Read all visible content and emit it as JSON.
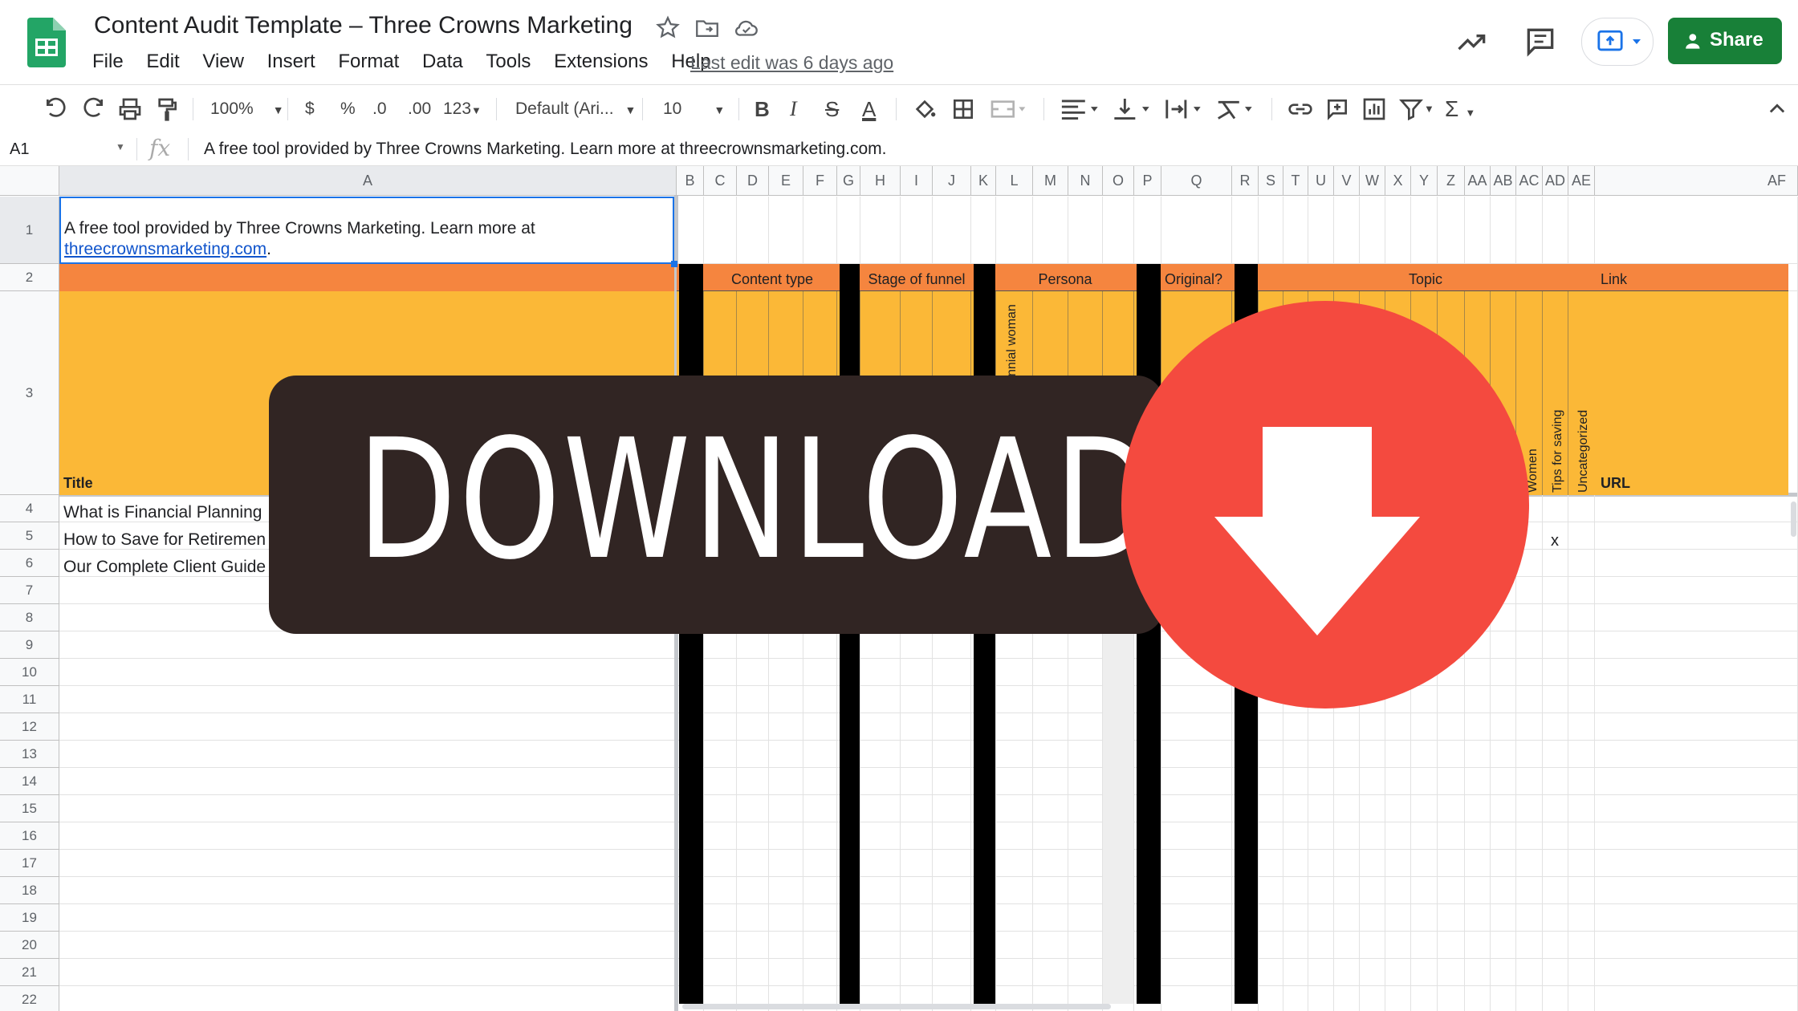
{
  "app": {
    "doc_title": "Content Audit Template – Three Crowns Marketing",
    "menu": [
      "File",
      "Edit",
      "View",
      "Insert",
      "Format",
      "Data",
      "Tools",
      "Extensions",
      "Help"
    ],
    "last_edit": "Last edit was 6 days ago",
    "share_label": "Share"
  },
  "toolbar": {
    "zoom": "100%",
    "currency": "$",
    "percent": "%",
    "dec_less": ".0",
    "dec_more": ".00",
    "number_format": "123",
    "font": "Default (Ari...",
    "font_size": "10"
  },
  "formula_bar": {
    "cell_ref": "A1",
    "fx": "fx",
    "content": "A free tool provided by Three Crowns Marketing. Learn more at threecrownsmarketing.com."
  },
  "grid": {
    "columns": [
      "A",
      "B",
      "C",
      "D",
      "E",
      "F",
      "G",
      "H",
      "I",
      "J",
      "K",
      "L",
      "M",
      "N",
      "O",
      "P",
      "Q",
      "R",
      "S",
      "T",
      "U",
      "V",
      "W",
      "X",
      "Y",
      "Z",
      "AA",
      "AB",
      "AC",
      "AD",
      "AE",
      "AF"
    ],
    "rows": [
      "1",
      "2",
      "3",
      "4",
      "5",
      "6",
      "7",
      "8",
      "9",
      "10",
      "11",
      "12",
      "13",
      "14",
      "15",
      "16",
      "17",
      "18",
      "19",
      "20",
      "21",
      "22"
    ],
    "a1_text": "A free tool provided by Three Crowns Marketing. Learn more at",
    "a1_link": "threecrownsmarketing.com",
    "a1_period": ".",
    "groups": {
      "content_type": "Content type",
      "stage_of_funnel": "Stage of funnel",
      "persona": "Persona",
      "original": "Original?",
      "topic": "Topic",
      "link": "Link"
    },
    "title_header": "Title",
    "url_header": "URL",
    "vertical_labels": {
      "persona_l": "nnial woman",
      "women": "Women",
      "tips": "Tips for saving",
      "uncategorized": "Uncategorized"
    },
    "rows_data": [
      "What is Financial Planning",
      "How to Save for Retiremen",
      "Our Complete Client Guide"
    ],
    "mark_x": "x"
  },
  "overlay": {
    "download_text": "DOWNLOAD"
  },
  "colors": {
    "orange_band": "#f5853f",
    "yellow_band": "#fbb837",
    "share_green": "#188038",
    "download_red": "#f44a3f",
    "banner_dark": "#312523"
  }
}
